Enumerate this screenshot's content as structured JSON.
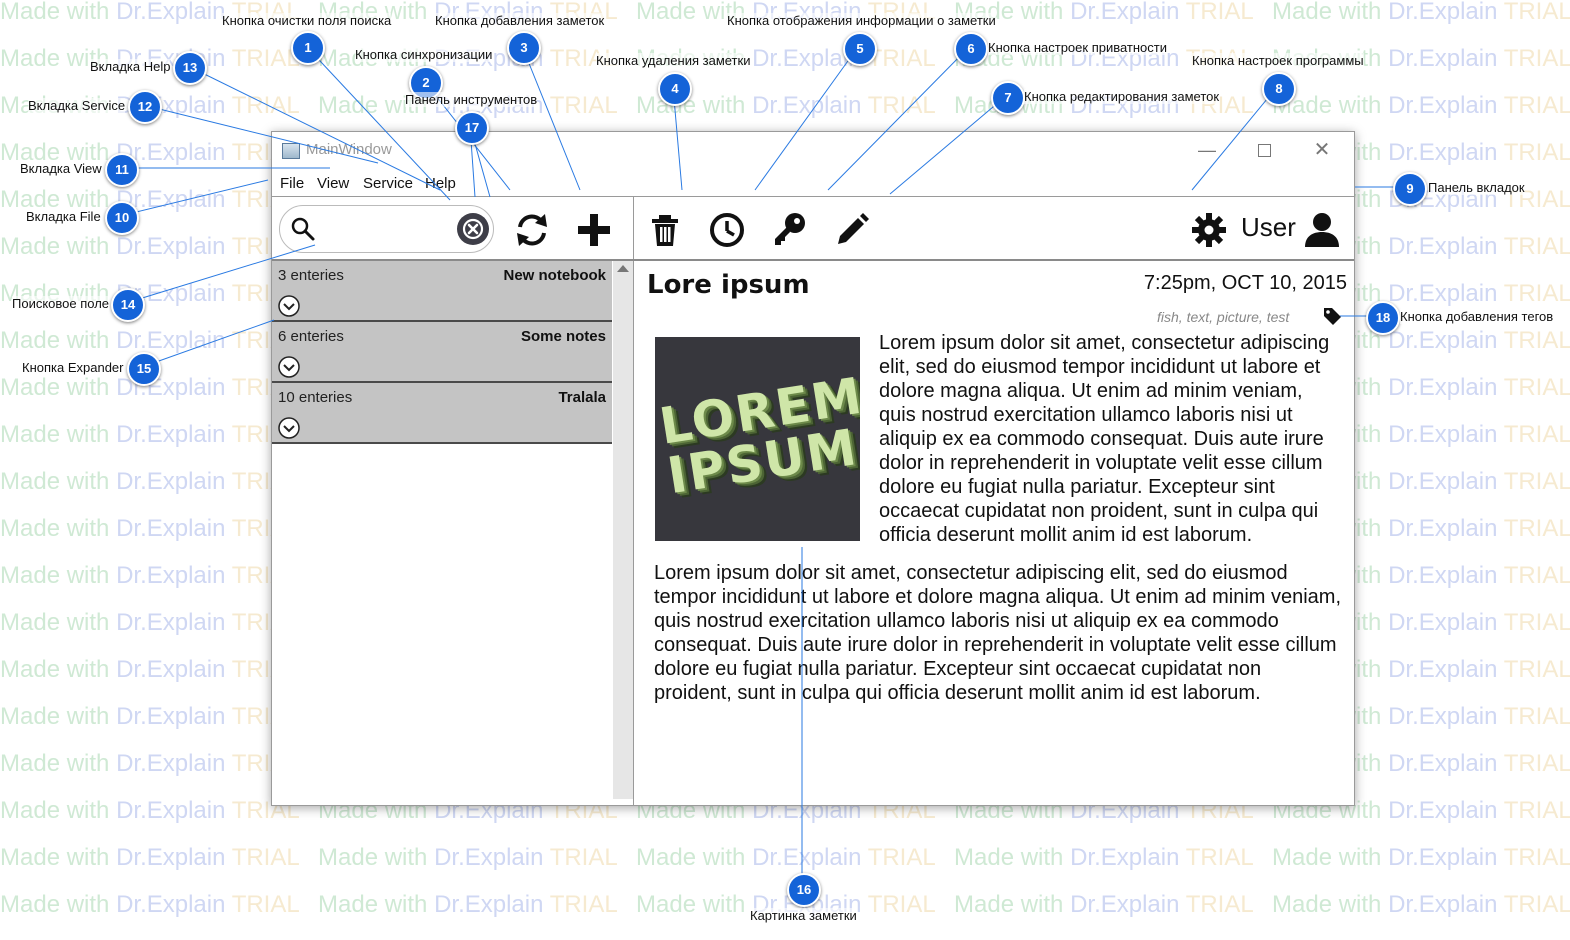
{
  "watermark": {
    "made": "Made with ",
    "dr": "Dr.Explain",
    "trial": " TRIAL"
  },
  "window": {
    "title": "MainWindow",
    "controls": {
      "minimize": "—",
      "close": "✕"
    }
  },
  "menu": {
    "file": "File",
    "view": "View",
    "service": "Service",
    "help": "Help"
  },
  "search": {
    "value": "",
    "placeholder": ""
  },
  "user": {
    "label": "User"
  },
  "notebooks": [
    {
      "count": "3 enteries",
      "name": "New notebook"
    },
    {
      "count": "6 enteries",
      "name": "Some notes"
    },
    {
      "count": "10 enteries",
      "name": "Tralala"
    }
  ],
  "note": {
    "title": "Lore ipsum",
    "date": "7:25pm, OCT 10, 2015",
    "tags": "fish, text, picture, test",
    "image_text": "LOREM IPSUM",
    "paragraph1": " Lorem ipsum dolor sit amet, consectetur adipiscing elit, sed do eiusmod tempor incididunt ut labore et dolore magna aliqua. Ut enim ad minim veniam, quis nostrud exercitation ullamco laboris nisi ut aliquip ex ea commodo consequat. Duis aute irure dolor in reprehenderit in voluptate velit esse cillum dolore eu fugiat nulla pariatur. Excepteur sint occaecat cupidatat non proident, sunt in culpa qui officia deserunt mollit anim id est laborum.",
    "paragraph2": "Lorem ipsum dolor sit amet, consectetur adipiscing elit, sed do eiusmod tempor incididunt ut labore et dolore magna aliqua. Ut enim ad minim veniam, quis nostrud exercitation ullamco laboris nisi ut aliquip ex ea commodo consequat. Duis aute irure dolor in reprehenderit in voluptate velit esse cillum dolore eu fugiat nulla pariatur. Excepteur sint occaecat cupidatat non proident, sunt in culpa qui officia deserunt mollit anim id est laborum."
  },
  "annotations": [
    {
      "num": "1",
      "label": "Кнопка очистки поля поиска"
    },
    {
      "num": "2",
      "label": "Кнопка синхронизации"
    },
    {
      "num": "3",
      "label": "Кнопка добавления заметок"
    },
    {
      "num": "4",
      "label": "Кнопка удаления заметки"
    },
    {
      "num": "5",
      "label": "Кнопка отображения информации о заметки"
    },
    {
      "num": "6",
      "label": "Кнопка настроек приватности"
    },
    {
      "num": "7",
      "label": "Кнопка редактирования заметок"
    },
    {
      "num": "8",
      "label": "Кнопка настроек программы"
    },
    {
      "num": "9",
      "label": "Панель вкладок"
    },
    {
      "num": "10",
      "label": "Вкладка File"
    },
    {
      "num": "11",
      "label": "Вкладка View"
    },
    {
      "num": "12",
      "label": "Вкладка Service"
    },
    {
      "num": "13",
      "label": "Вкладка Help"
    },
    {
      "num": "14",
      "label": "Поисковое поле"
    },
    {
      "num": "15",
      "label": "Кнопка Expander"
    },
    {
      "num": "16",
      "label": "Картинка заметки"
    },
    {
      "num": "17",
      "label": "Панель инструментов"
    },
    {
      "num": "18",
      "label": "Кнопка добавления тегов"
    }
  ],
  "colors": {
    "badge": "#1463d8",
    "list_item_bg": "#c4c4c4",
    "image_bg": "#37373d"
  }
}
